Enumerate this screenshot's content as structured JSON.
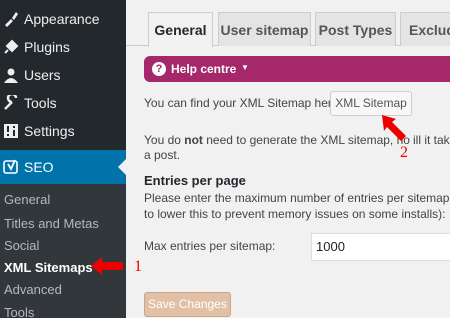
{
  "sidebar": {
    "items": [
      {
        "label": "Appearance",
        "icon": "paintbrush-icon"
      },
      {
        "label": "Plugins",
        "icon": "plugin-icon"
      },
      {
        "label": "Users",
        "icon": "users-icon"
      },
      {
        "label": "Tools",
        "icon": "wrench-icon"
      },
      {
        "label": "Settings",
        "icon": "settings-icon"
      },
      {
        "label": "SEO",
        "icon": "yoast-icon"
      }
    ],
    "submenu": [
      "General",
      "Titles and Metas",
      "Social",
      "XML Sitemaps",
      "Advanced",
      "Tools"
    ]
  },
  "tabs": [
    "General",
    "User sitemap",
    "Post Types",
    "Exclude"
  ],
  "help": {
    "label": "Help centre"
  },
  "content": {
    "find_text": "You can find your XML Sitemap here:",
    "xml_button": "XML Sitemap",
    "not_gen_pre": "You do ",
    "not_gen_bold": "not",
    "not_gen_post": " need to generate the XML sitemap, no",
    "not_gen_tail": "ill it take",
    "line3": "a post.",
    "entries_heading": "Entries per page",
    "entries_desc1": "Please enter the maximum number of entries per sitemap pa",
    "entries_desc2": "to lower this to prevent memory issues on some installs):",
    "max_label": "Max entries per sitemap:",
    "max_value": "1000",
    "save": "Save Changes"
  },
  "annotations": {
    "one": "1",
    "two": "2"
  },
  "colors": {
    "sidebar": "#23282d",
    "active": "#0073aa",
    "help": "#a4286a",
    "annotation": "#e00000"
  }
}
